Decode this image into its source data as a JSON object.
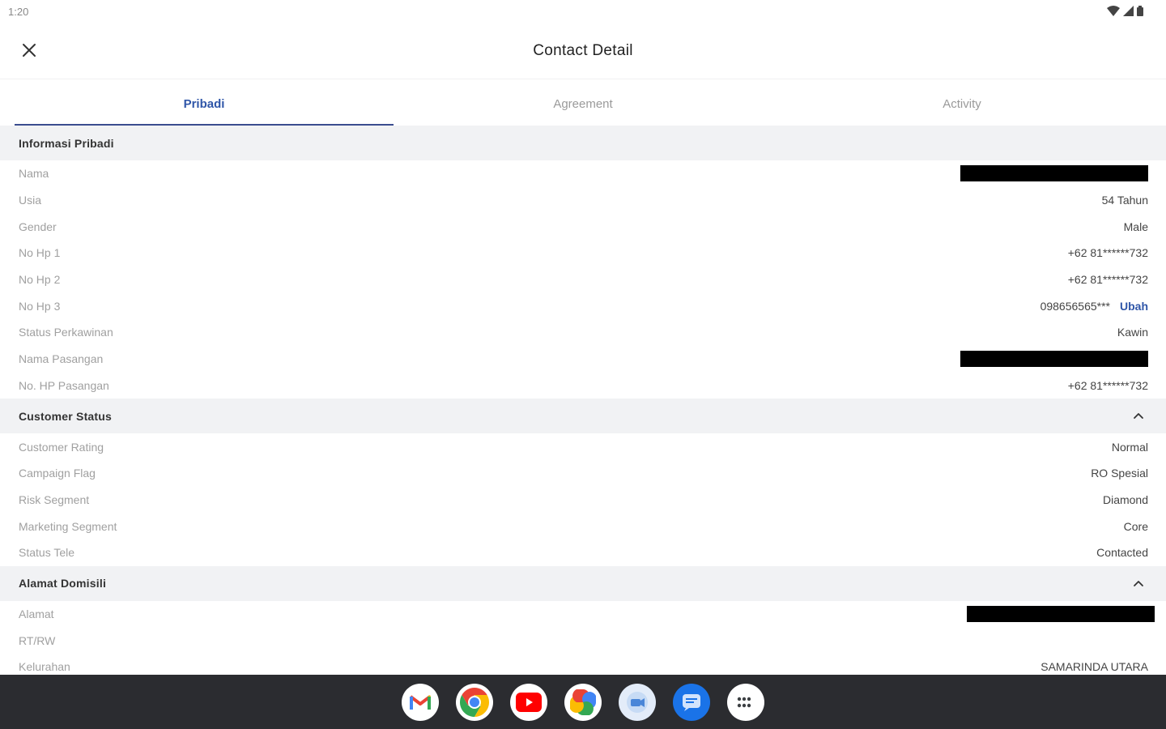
{
  "status_bar": {
    "time": "1:20"
  },
  "app_bar": {
    "title": "Contact Detail"
  },
  "tabs": [
    {
      "label": "Pribadi",
      "active": true
    },
    {
      "label": "Agreement",
      "active": false
    },
    {
      "label": "Activity",
      "active": false
    }
  ],
  "sections": {
    "pribadi": {
      "title": "Informasi Pribadi",
      "rows": [
        {
          "label": "Nama",
          "value": "",
          "redacted": true
        },
        {
          "label": "Usia",
          "value": "54 Tahun"
        },
        {
          "label": "Gender",
          "value": "Male"
        },
        {
          "label": "No Hp 1",
          "value": "+62 81******732"
        },
        {
          "label": "No Hp 2",
          "value": "+62 81******732"
        },
        {
          "label": "No Hp 3",
          "value": "098656565***",
          "action": "Ubah"
        },
        {
          "label": "Status Perkawinan",
          "value": "Kawin"
        },
        {
          "label": "Nama Pasangan",
          "value": "",
          "redacted": true
        },
        {
          "label": "No. HP Pasangan",
          "value": "+62 81******732"
        }
      ]
    },
    "customer_status": {
      "title": "Customer Status",
      "rows": [
        {
          "label": "Customer Rating",
          "value": "Normal"
        },
        {
          "label": "Campaign Flag",
          "value": "RO Spesial"
        },
        {
          "label": "Risk Segment",
          "value": "Diamond"
        },
        {
          "label": "Marketing Segment",
          "value": "Core"
        },
        {
          "label": "Status Tele",
          "value": "Contacted"
        }
      ]
    },
    "alamat": {
      "title": "Alamat Domisili",
      "rows": [
        {
          "label": "Alamat",
          "value": "",
          "redacted": true
        },
        {
          "label": "RT/RW",
          "value": ""
        },
        {
          "label": "Kelurahan",
          "value": "SAMARINDA UTARA"
        }
      ]
    }
  },
  "taskbar": {
    "apps": [
      "gmail-icon",
      "chrome-icon",
      "youtube-icon",
      "photos-icon",
      "meet-icon",
      "messages-icon",
      "app-launcher-icon"
    ]
  },
  "colors": {
    "accent": "#2f56a8",
    "section_bg": "#f1f2f4",
    "taskbar_bg": "#2b2c30"
  }
}
